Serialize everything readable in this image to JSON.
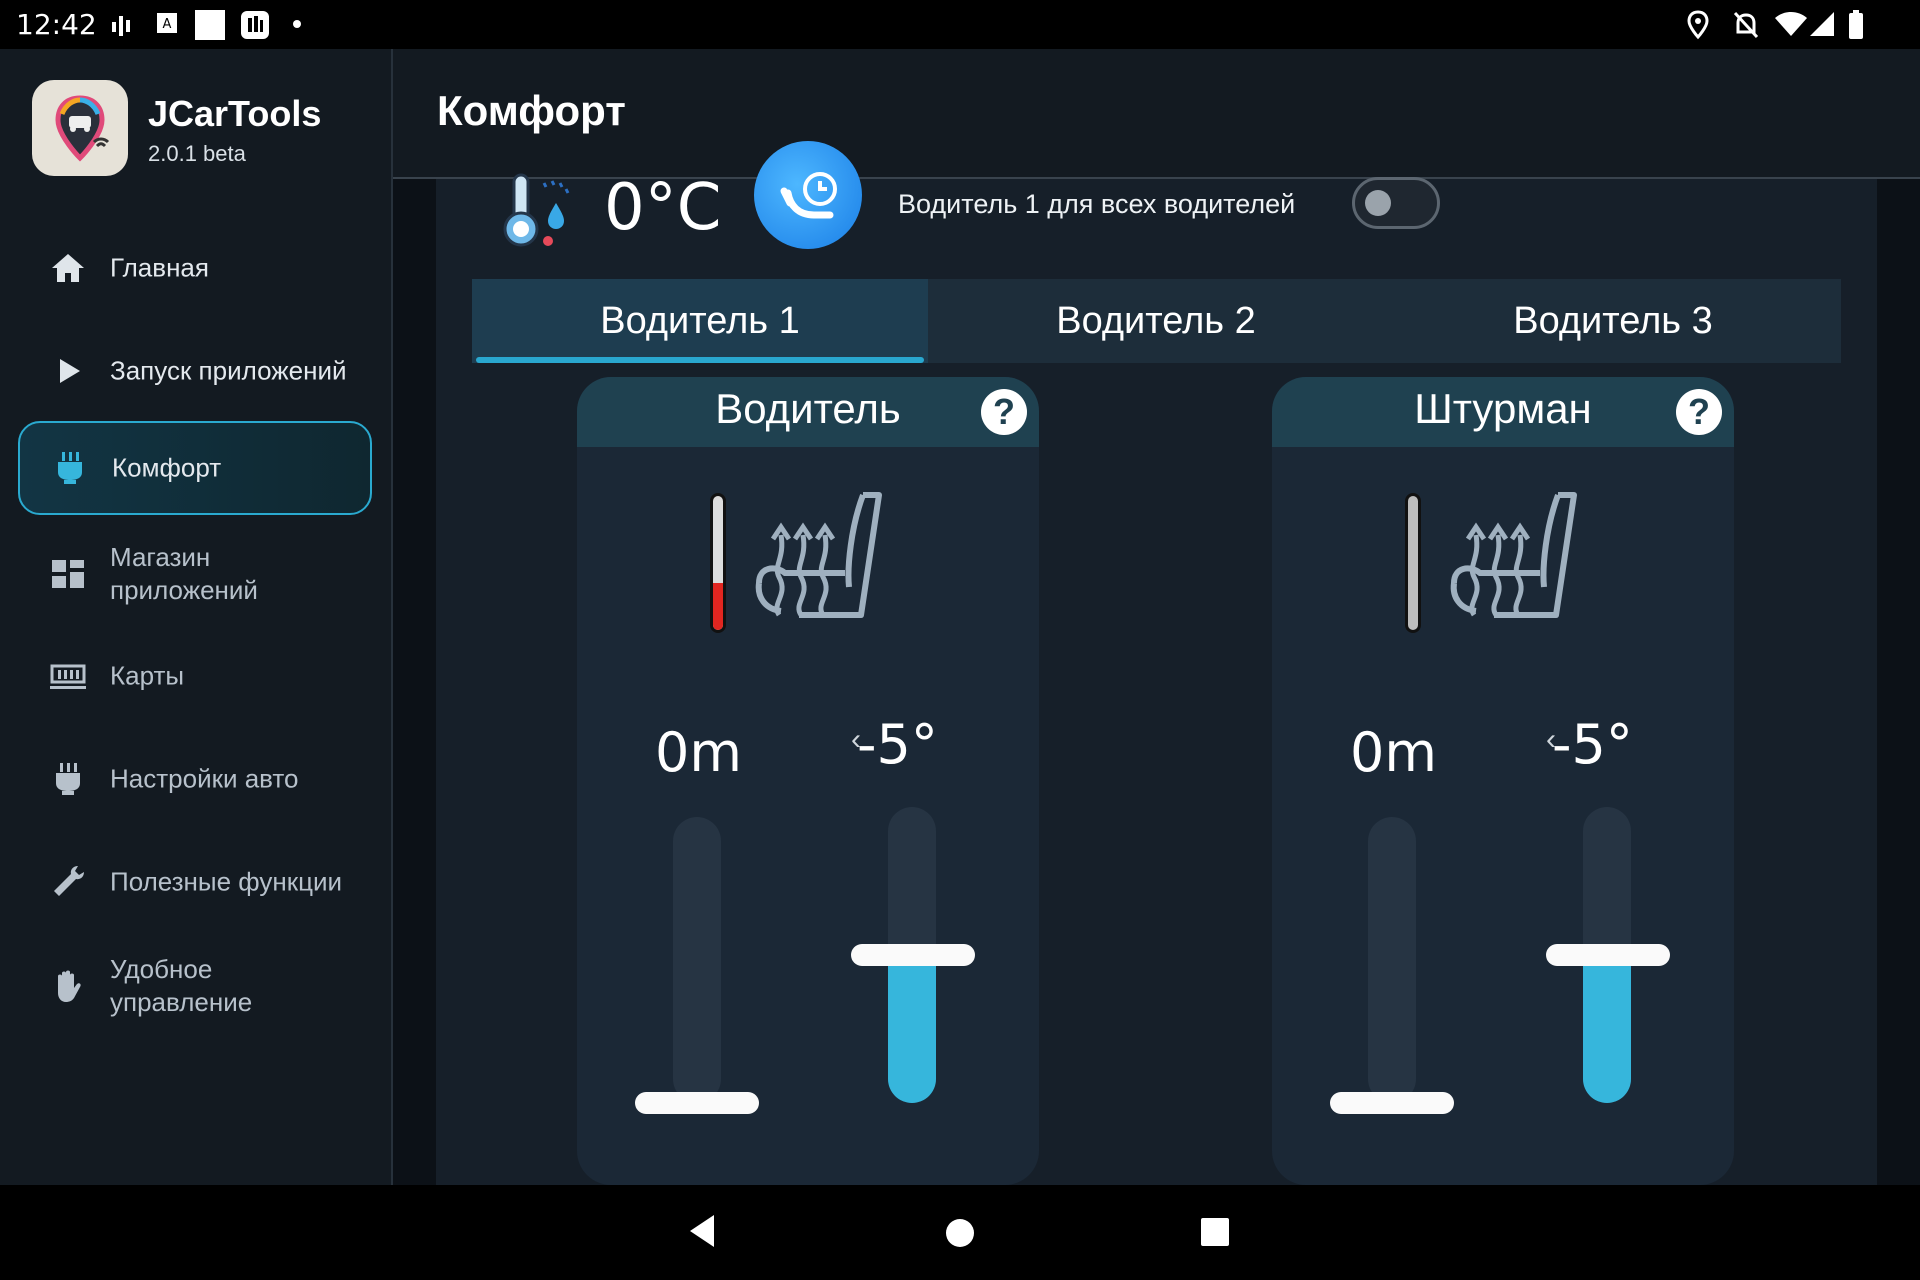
{
  "status_bar": {
    "time": "12:42"
  },
  "app": {
    "name": "JCarTools",
    "version": "2.0.1 beta"
  },
  "sidebar": {
    "items": [
      {
        "label": "Главная",
        "icon": "home-icon",
        "active": false
      },
      {
        "label": "Запуск приложений",
        "icon": "play-icon",
        "active": false
      },
      {
        "label": "Комфорт",
        "icon": "seat-plug-icon",
        "active": true
      },
      {
        "label": "Магазин\nприложений",
        "icon": "grid-icon",
        "active": false
      },
      {
        "label": "Карты",
        "icon": "map-icon",
        "active": false
      },
      {
        "label": "Настройки авто",
        "icon": "car-settings-icon",
        "active": false
      },
      {
        "label": "Полезные функции",
        "icon": "wrench-icon",
        "active": false
      },
      {
        "label": "Удобное\nуправление",
        "icon": "hand-icon",
        "active": false
      }
    ]
  },
  "header": {
    "title": "Комфорт"
  },
  "comfort": {
    "outside_temp": "0°C",
    "toggle_label": "Водитель 1 для всех водителей",
    "toggle_on": false,
    "tabs": [
      "Водитель 1",
      "Водитель 2",
      "Водитель 3"
    ],
    "active_tab": 0,
    "cards": [
      {
        "title": "Водитель",
        "help": "?",
        "heat_level": 0.35,
        "timer": "0m",
        "angle": "-5°",
        "timer_level": 0.0,
        "angle_level": 0.5
      },
      {
        "title": "Штурман",
        "help": "?",
        "heat_level": 0.0,
        "timer": "0m",
        "angle": "-5°",
        "timer_level": 0.0,
        "angle_level": 0.5
      }
    ]
  },
  "colors": {
    "accent": "#36b6dc",
    "heat": "#e22620",
    "active_nav_border": "#2aaad0",
    "card_header": "#1f4150"
  }
}
